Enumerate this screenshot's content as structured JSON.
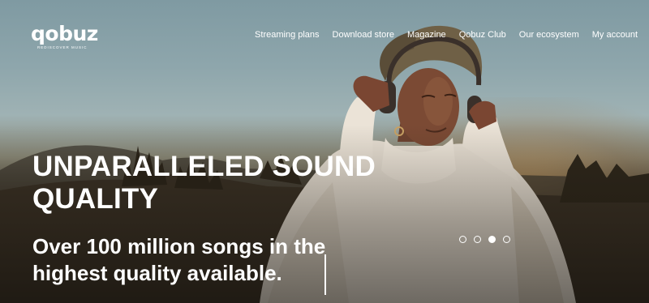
{
  "brand": {
    "logo_text": "qobuz",
    "tagline": "REDISCOVER MUSIC"
  },
  "nav": {
    "items": [
      {
        "label": "Streaming plans"
      },
      {
        "label": "Download store"
      },
      {
        "label": "Magazine"
      },
      {
        "label": "Qobuz Club"
      },
      {
        "label": "Our ecosystem"
      },
      {
        "label": "My account"
      }
    ]
  },
  "hero": {
    "headline": "UNPARALLELED SOUND QUALITY",
    "subline": "Over 100 million songs in the highest quality available."
  },
  "carousel": {
    "slide_count": 4,
    "active_index": 2
  },
  "colors": {
    "text": "#ffffff",
    "sky": "#8ea6ac",
    "ground": "#2e281e",
    "sweater": "#e8e0d4"
  }
}
